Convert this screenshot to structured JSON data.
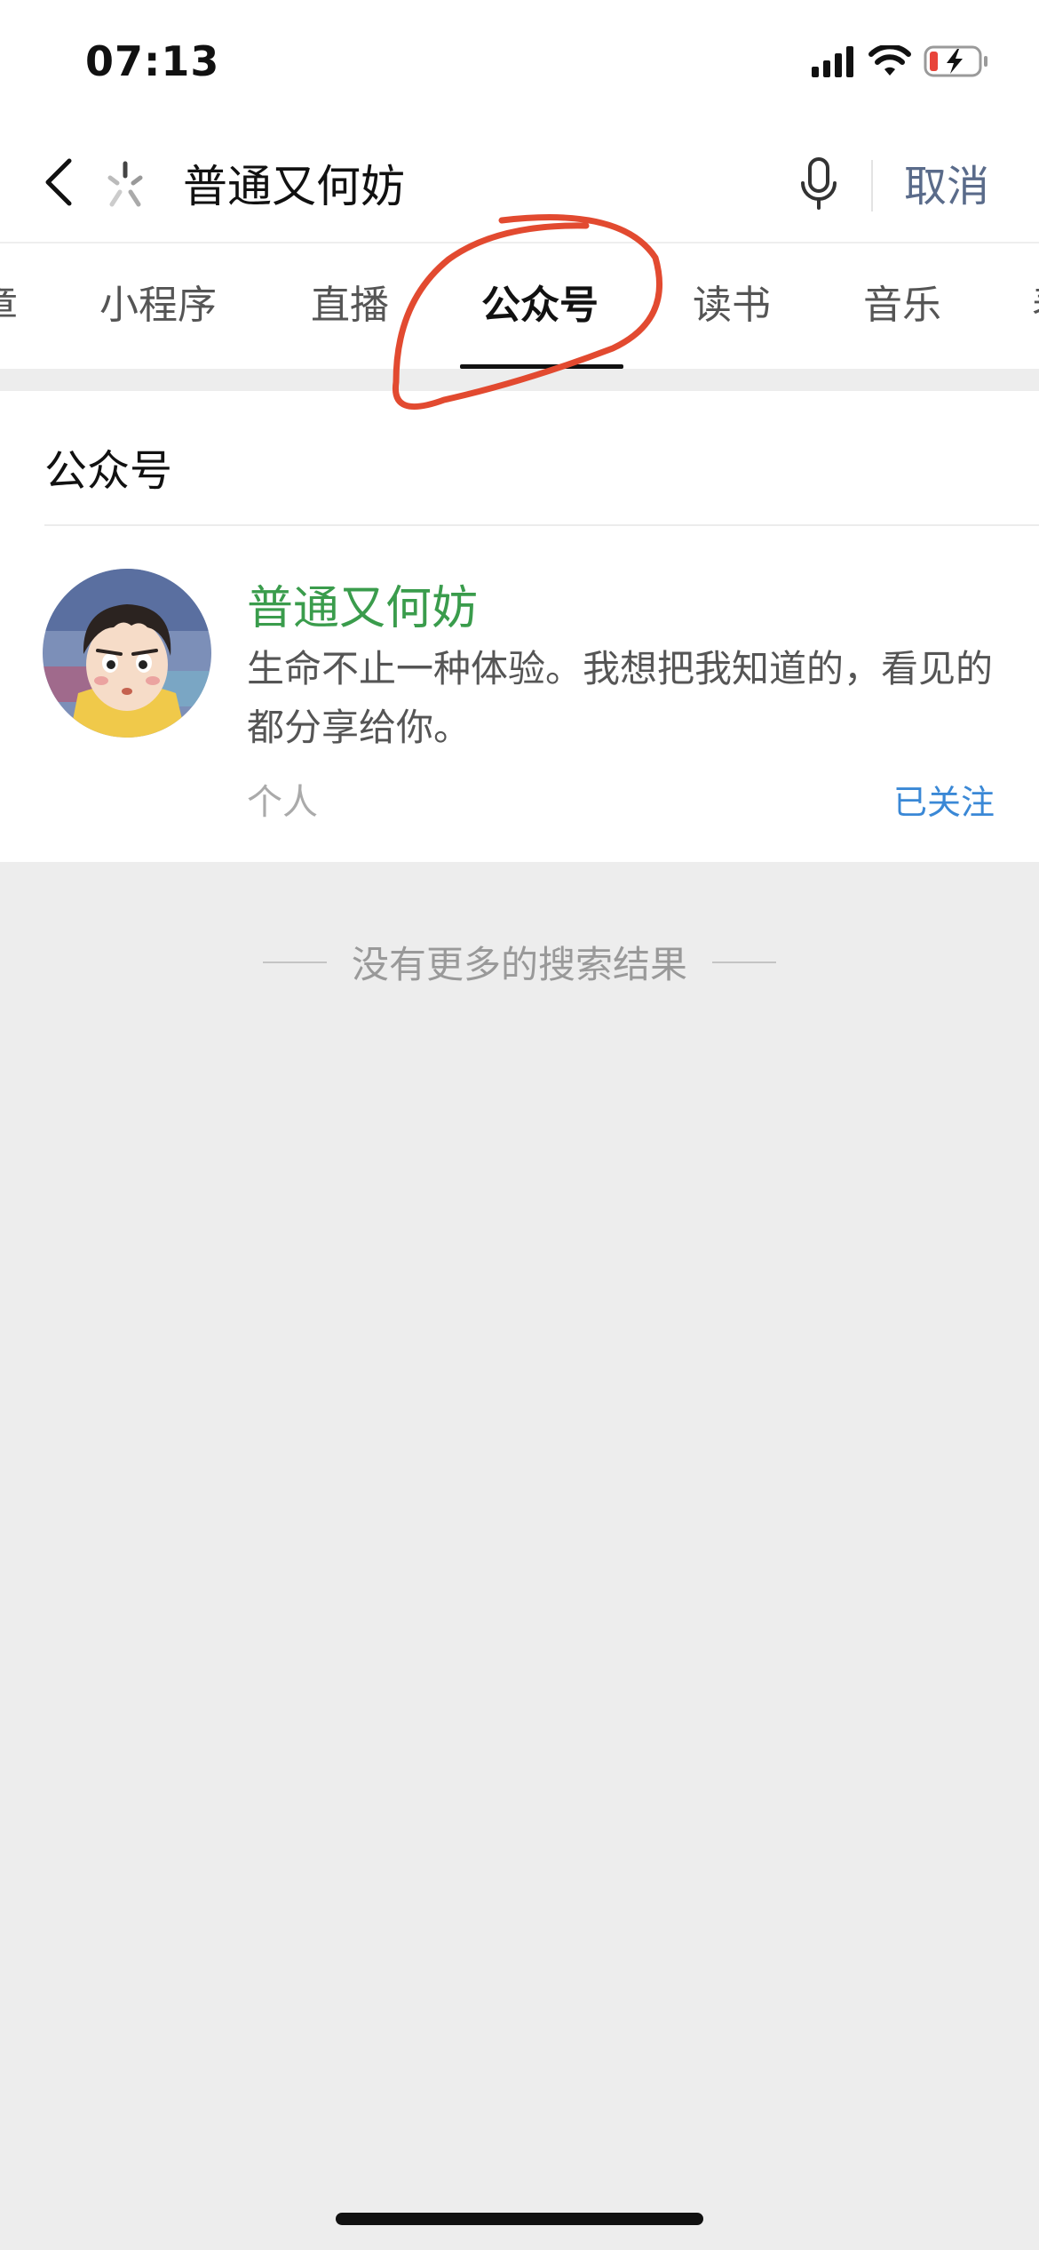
{
  "status_bar": {
    "time": "07:13",
    "icons": [
      "signal-icon",
      "wifi-icon",
      "battery-charging-icon"
    ]
  },
  "search": {
    "query": "普通又何妨",
    "cancel_label": "取消",
    "icons": [
      "back-icon",
      "loading-icon",
      "microphone-icon"
    ]
  },
  "tabs": [
    {
      "label": "章",
      "active": false
    },
    {
      "label": "小程序",
      "active": false
    },
    {
      "label": "直播",
      "active": false
    },
    {
      "label": "公众号",
      "active": true
    },
    {
      "label": "读书",
      "active": false
    },
    {
      "label": "音乐",
      "active": false
    },
    {
      "label": "表",
      "active": false
    }
  ],
  "results": {
    "section_title": "公众号",
    "items": [
      {
        "name": "普通又何妨",
        "description": "生命不止一种体验。我想把我知道的，看见的都分享给你。",
        "type": "个人",
        "follow_status": "已关注"
      }
    ]
  },
  "footer": {
    "no_more_text": "没有更多的搜索结果"
  },
  "colors": {
    "account_name": "#3a9c4c",
    "follow_status": "#3a88d6",
    "annotation": "#e24a30",
    "background": "#ededed"
  }
}
